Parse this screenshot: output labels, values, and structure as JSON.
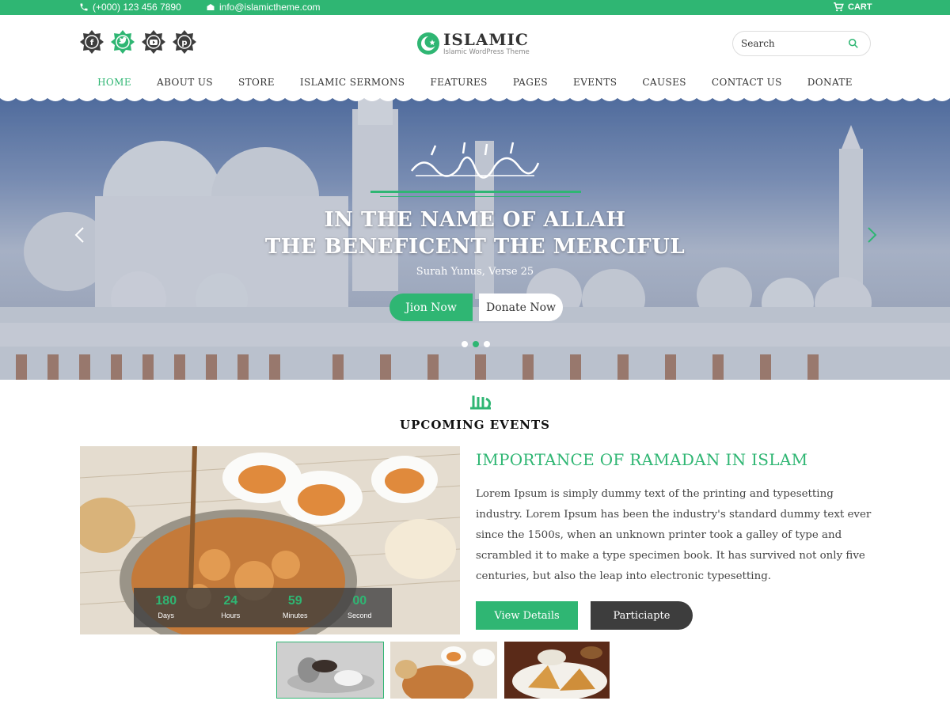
{
  "topbar": {
    "phone": "(+000) 123 456 7890",
    "email": "info@islamictheme.com",
    "cart_label": "CART",
    "icons": [
      "phone-icon",
      "envelope-icon",
      "cart-icon"
    ]
  },
  "header": {
    "social_icons": [
      "facebook-icon",
      "twitter-icon",
      "youtube-icon",
      "pinterest-icon"
    ],
    "logo": {
      "name": "ISLAMIC",
      "tagline": "Islamic WordPress Theme"
    },
    "search": {
      "placeholder": "Search",
      "icon": "search-icon"
    }
  },
  "nav": {
    "items": [
      {
        "label": "HOME",
        "active": true
      },
      {
        "label": "ABOUT US"
      },
      {
        "label": "STORE"
      },
      {
        "label": "ISLAMIC SERMONS"
      },
      {
        "label": "FEATURES"
      },
      {
        "label": "PAGES"
      },
      {
        "label": "EVENTS"
      },
      {
        "label": "CAUSES"
      },
      {
        "label": "CONTACT US"
      },
      {
        "label": "DONATE"
      }
    ]
  },
  "hero": {
    "title_line1": "IN THE NAME OF ALLAH",
    "title_line2": "THE BENEFICENT THE MERCIFUL",
    "verse": "Surah Yunus, Verse 25",
    "join_label": "Jion Now",
    "donate_label": "Donate Now",
    "slide_count": 3,
    "active_slide": 2
  },
  "events": {
    "section_title": "UPCOMING EVENTS",
    "event_title": "IMPORTANCE OF RAMADAN  IN ISLAM",
    "description": "Lorem Ipsum is simply dummy text of the printing and typesetting industry. Lorem Ipsum has been the industry's standard dummy text ever since the 1500s, when an unknown printer took a galley of type and scrambled it to make a type specimen book. It has survived not only five centuries, but also the leap into electronic typesetting.",
    "countdown": [
      {
        "value": "180",
        "label": "Days"
      },
      {
        "value": "24",
        "label": "Hours"
      },
      {
        "value": "59",
        "label": "Minutes"
      },
      {
        "value": "00",
        "label": "Second"
      }
    ],
    "view_details_label": "View Details",
    "participate_label": "Particiapte"
  },
  "colors": {
    "accent": "#2fb673",
    "dark": "#3d3d3d",
    "text": "#333333"
  }
}
